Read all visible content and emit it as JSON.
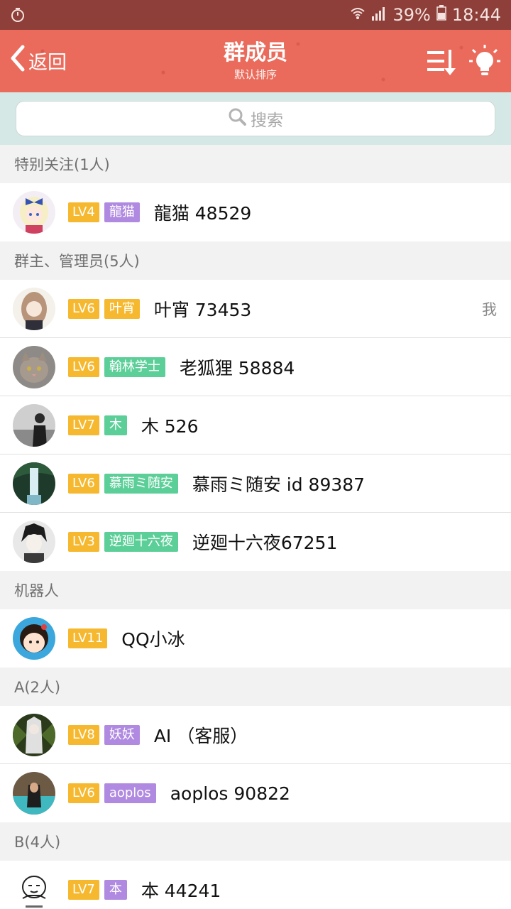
{
  "status_bar": {
    "battery_text": "39%",
    "time": "18:44",
    "icons": [
      "timer-icon",
      "wifi-icon",
      "signal-icon",
      "battery-icon"
    ]
  },
  "header": {
    "back_label": "返回",
    "title": "群成员",
    "subtitle": "默认排序",
    "icons": [
      "back-chevron-icon",
      "sort-icon",
      "lightbulb-icon"
    ],
    "color": "#ea6b5b"
  },
  "search": {
    "placeholder": "搜索"
  },
  "sections": [
    {
      "title": "特别关注(1人)",
      "members": [
        {
          "level": "LV4",
          "tag": "龍猫",
          "tag_color": "purple",
          "name": "龍猫 48529",
          "me": ""
        }
      ]
    },
    {
      "title": "群主、管理员(5人)",
      "members": [
        {
          "level": "LV6",
          "tag": "叶宵",
          "tag_color": "yellow",
          "name": "叶宵 73453",
          "me": "我"
        },
        {
          "level": "LV6",
          "tag": "翰林学士",
          "tag_color": "green",
          "name": "老狐狸 58884",
          "me": ""
        },
        {
          "level": "LV7",
          "tag": "木",
          "tag_color": "green",
          "name": "木 526",
          "me": ""
        },
        {
          "level": "LV6",
          "tag": "慕雨ミ随安",
          "tag_color": "green",
          "name": "慕雨ミ随安 id 89387",
          "me": ""
        },
        {
          "level": "LV3",
          "tag": "逆廻十六夜",
          "tag_color": "green",
          "name": "逆廻十六夜67251",
          "me": ""
        }
      ]
    },
    {
      "title": "机器人",
      "members": [
        {
          "level": "LV11",
          "tag": "",
          "tag_color": "",
          "name": "QQ小冰",
          "me": ""
        }
      ]
    },
    {
      "title": "A(2人)",
      "members": [
        {
          "level": "LV8",
          "tag": "妖妖",
          "tag_color": "purple",
          "name": "AI （客服）",
          "me": ""
        },
        {
          "level": "LV6",
          "tag": "aoplos",
          "tag_color": "purple",
          "name": "aoplos 90822",
          "me": ""
        }
      ]
    },
    {
      "title": "B(4人)",
      "members": [
        {
          "level": "LV7",
          "tag": "本",
          "tag_color": "purple",
          "name": "本 44241",
          "me": ""
        }
      ]
    }
  ]
}
